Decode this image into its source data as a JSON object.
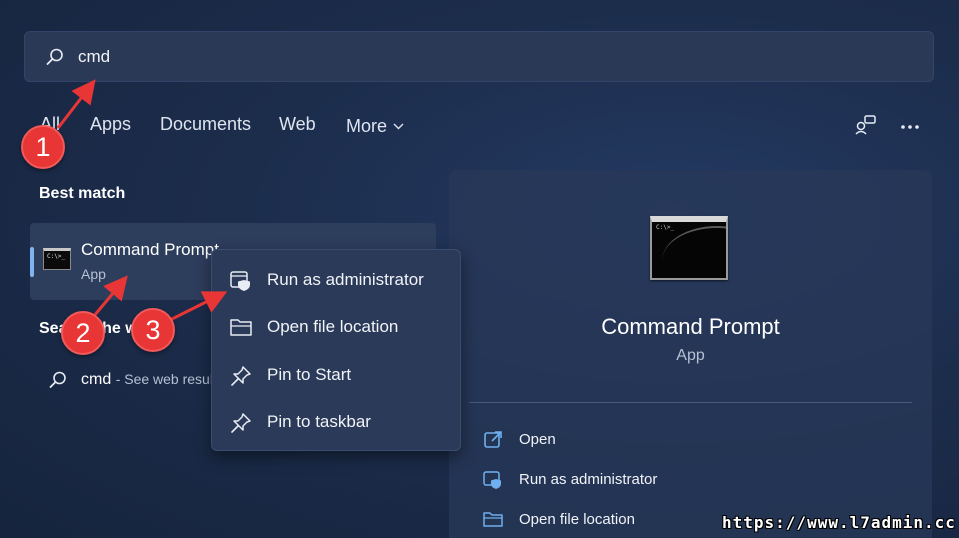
{
  "search": {
    "query": "cmd"
  },
  "tabs": [
    {
      "label": "All"
    },
    {
      "label": "Apps"
    },
    {
      "label": "Documents"
    },
    {
      "label": "Web"
    },
    {
      "label": "More"
    }
  ],
  "best_match": {
    "heading": "Best match",
    "title": "Command Prompt",
    "subtitle": "App"
  },
  "search_web": {
    "heading": "Search the web",
    "query": "cmd",
    "suffix": "- See web results"
  },
  "context_menu": [
    {
      "label": "Run as administrator",
      "icon": "shield-window-icon"
    },
    {
      "label": "Open file location",
      "icon": "folder-icon"
    },
    {
      "label": "Pin to Start",
      "icon": "pin-icon"
    },
    {
      "label": "Pin to taskbar",
      "icon": "pin-icon"
    }
  ],
  "detail": {
    "title": "Command Prompt",
    "subtitle": "App",
    "actions": [
      {
        "label": "Open",
        "icon": "open-external-icon"
      },
      {
        "label": "Run as administrator",
        "icon": "shield-window-icon"
      },
      {
        "label": "Open file location",
        "icon": "folder-icon"
      }
    ]
  },
  "annotations": [
    {
      "label": "1"
    },
    {
      "label": "2"
    },
    {
      "label": "3"
    }
  ],
  "watermark": "https://www.l7admin.cc",
  "colors": {
    "accent": "#7fb4f0",
    "badge": "#e83535",
    "panel": "#283858"
  }
}
